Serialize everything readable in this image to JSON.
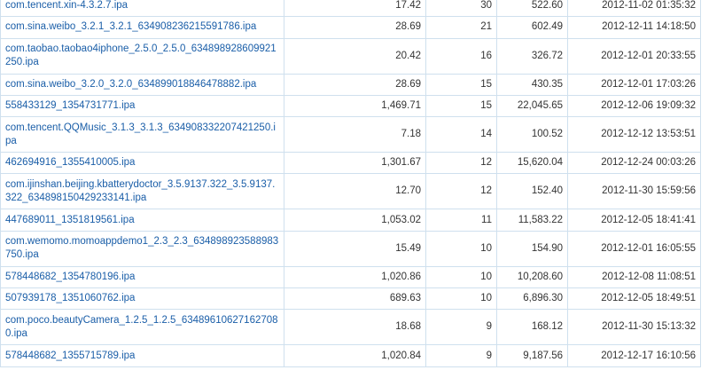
{
  "table": {
    "rows": [
      {
        "name": "com.tencent.xin-4.3.2.7.ipa",
        "size": "17.42",
        "count": "30",
        "total": "522.60",
        "time": "2012-11-02 01:35:32"
      },
      {
        "name": "com.sina.weibo_3.2.1_3.2.1_634908236215591786.ipa",
        "size": "28.69",
        "count": "21",
        "total": "602.49",
        "time": "2012-12-11 14:18:50"
      },
      {
        "name": "com.taobao.taobao4iphone_2.5.0_2.5.0_634898928609921250.ipa",
        "size": "20.42",
        "count": "16",
        "total": "326.72",
        "time": "2012-12-01 20:33:55"
      },
      {
        "name": "com.sina.weibo_3.2.0_3.2.0_634899018846478882.ipa",
        "size": "28.69",
        "count": "15",
        "total": "430.35",
        "time": "2012-12-01 17:03:26"
      },
      {
        "name": "558433129_1354731771.ipa",
        "size": "1,469.71",
        "count": "15",
        "total": "22,045.65",
        "time": "2012-12-06 19:09:32"
      },
      {
        "name": "com.tencent.QQMusic_3.1.3_3.1.3_634908332207421250.ipa",
        "size": "7.18",
        "count": "14",
        "total": "100.52",
        "time": "2012-12-12 13:53:51"
      },
      {
        "name": "462694916_1355410005.ipa",
        "size": "1,301.67",
        "count": "12",
        "total": "15,620.04",
        "time": "2012-12-24 00:03:26"
      },
      {
        "name": "com.ijinshan.beijing.kbatterydoctor_3.5.9137.322_3.5.9137.322_634898150429233141.ipa",
        "size": "12.70",
        "count": "12",
        "total": "152.40",
        "time": "2012-11-30 15:59:56"
      },
      {
        "name": "447689011_1351819561.ipa",
        "size": "1,053.02",
        "count": "11",
        "total": "11,583.22",
        "time": "2012-12-05 18:41:41"
      },
      {
        "name": "com.wemomo.momoappdemo1_2.3_2.3_634898923588983750.ipa",
        "size": "15.49",
        "count": "10",
        "total": "154.90",
        "time": "2012-12-01 16:05:55"
      },
      {
        "name": "578448682_1354780196.ipa",
        "size": "1,020.86",
        "count": "10",
        "total": "10,208.60",
        "time": "2012-12-08 11:08:51"
      },
      {
        "name": "507939178_1351060762.ipa",
        "size": "689.63",
        "count": "10",
        "total": "6,896.30",
        "time": "2012-12-05 18:49:51"
      },
      {
        "name": "com.poco.beautyCamera_1.2.5_1.2.5_634896106271627080.ipa",
        "size": "18.68",
        "count": "9",
        "total": "168.12",
        "time": "2012-11-30 15:13:32"
      },
      {
        "name": "578448682_1355715789.ipa",
        "size": "1,020.84",
        "count": "9",
        "total": "9,187.56",
        "time": "2012-12-17 16:10:56"
      }
    ]
  }
}
